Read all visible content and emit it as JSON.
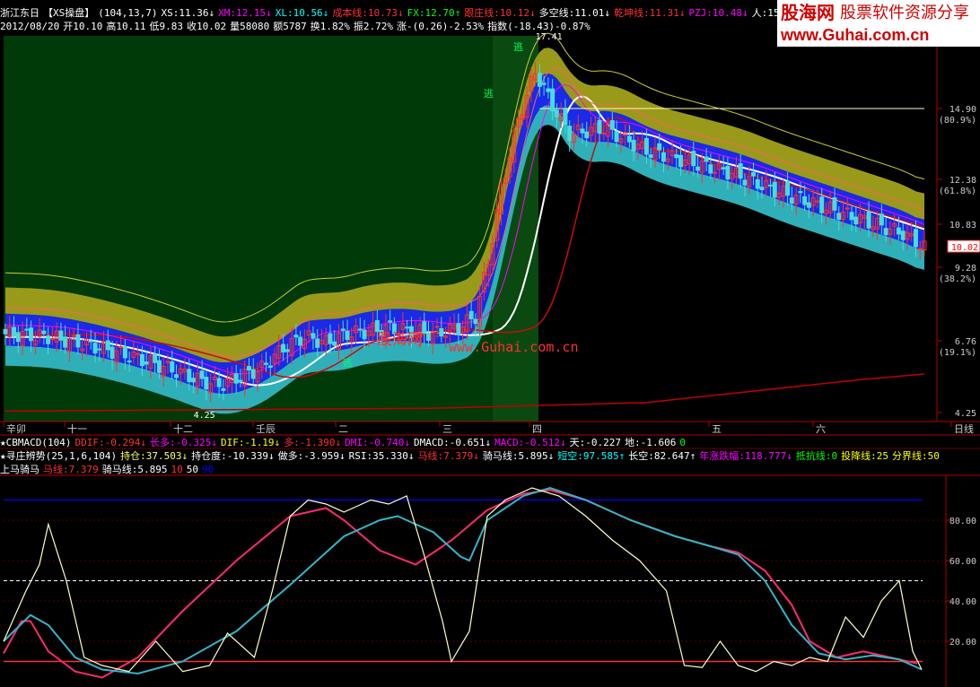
{
  "colors": {
    "bg": "#000000",
    "panel_bg": "#003300",
    "red": "#ff3030",
    "cyan": "#00ffff",
    "yellow": "#ffff00",
    "white": "#ffffff",
    "magenta": "#ff00ff",
    "blue": "#0000ff",
    "teal": "#33aaaa"
  },
  "header": {
    "row1": [
      {
        "t": "浙江东日",
        "c": "#ffffff"
      },
      {
        "t": "【XS操盘】",
        "c": "#ffffff"
      },
      {
        "t": "(104,13,7)",
        "c": "#ffffff"
      },
      {
        "t": "XS:11.36↓",
        "c": "#ffffff"
      },
      {
        "t": "XM:12.15↓",
        "c": "#ff00ff"
      },
      {
        "t": "XL:10.56↓",
        "c": "#00ffff"
      },
      {
        "t": "成本线:10.73↓",
        "c": "#ff3030"
      },
      {
        "t": "FX:12.70↑",
        "c": "#00ff00"
      },
      {
        "t": "跟庄线:10.12↓",
        "c": "#ff3030"
      },
      {
        "t": "多空线:11.01↓",
        "c": "#ffffff"
      },
      {
        "t": "乾坤线:11.31↓",
        "c": "#ff3030"
      },
      {
        "t": "PZJ:10.48↓",
        "c": "#ff00ff"
      },
      {
        "t": "人:15.0",
        "c": "#ffffff"
      }
    ],
    "row2": [
      {
        "t": "2012/08/20",
        "c": "#ffffff"
      },
      {
        "t": "开10.10",
        "c": "#ffffff"
      },
      {
        "t": "高10.11",
        "c": "#ffffff"
      },
      {
        "t": "低9.83",
        "c": "#ffffff"
      },
      {
        "t": "收10.02",
        "c": "#ffffff"
      },
      {
        "t": "量58080",
        "c": "#ffffff"
      },
      {
        "t": "额5787",
        "c": "#ffffff"
      },
      {
        "t": "换1.82%",
        "c": "#ffffff"
      },
      {
        "t": "振2.72%",
        "c": "#ffffff"
      },
      {
        "t": "涨-(0.26)-2.53%",
        "c": "#ffffff"
      },
      {
        "t": "指数(-18.43)-0.87%",
        "c": "#ffffff"
      }
    ]
  },
  "brand": {
    "line1": "股海网",
    "line2": "股票软件资源分享",
    "line3": "www.Guhai.com.cn"
  },
  "watermark": {
    "cn": "股海网",
    "url": "www.Guhai.com.cn"
  },
  "price_panel": {
    "annotations": {
      "peak": "17.41",
      "low": "4.25",
      "escape": "逃",
      "current": "10.02"
    },
    "y_axis": [
      {
        "price": "14.90",
        "pct": "(80.9%)",
        "v": 14.9
      },
      {
        "price": "12.38",
        "pct": "(61.8%)",
        "v": 12.38
      },
      {
        "price": "10.83",
        "pct": "",
        "v": 10.83
      },
      {
        "price": "9.28",
        "pct": "(38.2%)",
        "v": 9.28
      },
      {
        "price": "6.76",
        "pct": "(19.1%)",
        "v": 6.76
      },
      {
        "price": "4.25",
        "pct": "",
        "v": 4.25
      }
    ]
  },
  "time_axis": {
    "labels": [
      "辛卯",
      "十一",
      "十二",
      "壬辰",
      "二",
      "三",
      "四",
      "五",
      "六",
      "日线"
    ]
  },
  "indicator_rows": {
    "row1": [
      {
        "t": "★CBMACD(104)",
        "c": "#ffffff"
      },
      {
        "t": "DDIF:-0.294↓",
        "c": "#ff3030"
      },
      {
        "t": "长多:-0.325↓",
        "c": "#ff00ff"
      },
      {
        "t": "DIF:-1.19↓",
        "c": "#ffff00"
      },
      {
        "t": "多:-1.390↓",
        "c": "#ff3030"
      },
      {
        "t": "DMI:-0.740↓",
        "c": "#ff00ff"
      },
      {
        "t": "DMACD:-0.651↓",
        "c": "#ffffff"
      },
      {
        "t": "MACD:-0.512↓",
        "c": "#ff00ff"
      },
      {
        "t": "天:-0.227",
        "c": "#ffffff"
      },
      {
        "t": "地:-1.606",
        "c": "#ffffff"
      },
      {
        "t": "0",
        "c": "#00ff00"
      }
    ],
    "row2": [
      {
        "t": "★寻庄辨势(25,1,6,104)",
        "c": "#ffffff"
      },
      {
        "t": "持仓:37.503↓",
        "c": "#ffff66"
      },
      {
        "t": "持仓度:-10.339↓",
        "c": "#ffffff"
      },
      {
        "t": "做多:-3.959↓",
        "c": "#ffffff"
      },
      {
        "t": "RSI:35.330↓",
        "c": "#ffffff"
      },
      {
        "t": "马线:7.379↓",
        "c": "#ff3030"
      },
      {
        "t": "骑马线:5.895↓",
        "c": "#ffffff"
      },
      {
        "t": "短空:97.585↑",
        "c": "#00ffff"
      },
      {
        "t": "长空:82.647↑",
        "c": "#ffffff"
      },
      {
        "t": "年涨跌幅:118.777↓",
        "c": "#ff00ff"
      },
      {
        "t": "抵抗线:0",
        "c": "#00ff00"
      },
      {
        "t": "投降线:25",
        "c": "#ffff00"
      },
      {
        "t": "分界线:50",
        "c": "#ffff00"
      }
    ],
    "row3": [
      {
        "t": "上马骑马",
        "c": "#ffffff"
      },
      {
        "t": "马线:7.379",
        "c": "#ff3030"
      },
      {
        "t": "骑马线:5.895",
        "c": "#ffffff"
      },
      {
        "t": "10",
        "c": "#ff3030"
      },
      {
        "t": "50",
        "c": "#ffffff"
      },
      {
        "t": "90",
        "c": "#0000ff"
      }
    ]
  },
  "chart_data": [
    {
      "type": "candlestick",
      "title": "浙江东日【XS操盘】",
      "ylim": [
        4.25,
        17.41
      ],
      "y_ticks": [
        14.9,
        12.38,
        10.83,
        9.28,
        6.76,
        4.25
      ],
      "current_price": 10.02,
      "stage_price_path": [
        [
          0,
          7.0
        ],
        [
          10,
          6.9
        ],
        [
          20,
          6.6
        ],
        [
          30,
          6.2
        ],
        [
          40,
          5.7
        ],
        [
          45,
          5.4
        ],
        [
          50,
          5.2
        ],
        [
          55,
          5.5
        ],
        [
          60,
          5.8
        ],
        [
          65,
          6.5
        ],
        [
          70,
          6.9
        ],
        [
          75,
          6.7
        ],
        [
          80,
          7.0
        ],
        [
          90,
          7.2
        ],
        [
          100,
          7.0
        ],
        [
          106,
          7.2
        ],
        [
          110,
          7.6
        ],
        [
          113,
          9.5
        ],
        [
          116,
          12.0
        ],
        [
          120,
          14.5
        ],
        [
          124,
          16.2
        ],
        [
          128,
          15.0
        ],
        [
          132,
          14.0
        ],
        [
          140,
          14.2
        ],
        [
          150,
          13.4
        ],
        [
          160,
          13.0
        ],
        [
          170,
          12.6
        ],
        [
          180,
          12.0
        ],
        [
          190,
          11.5
        ],
        [
          200,
          11.0
        ],
        [
          210,
          10.5
        ],
        [
          215,
          10.0
        ]
      ],
      "support_line": [
        [
          0,
          4.3
        ],
        [
          100,
          4.4
        ],
        [
          150,
          4.6
        ],
        [
          200,
          5.4
        ],
        [
          215,
          5.6
        ]
      ],
      "resistance_line": [
        [
          125,
          14.9
        ],
        [
          215,
          14.9
        ]
      ]
    },
    {
      "type": "line",
      "title": "上马骑马",
      "ylim": [
        0,
        100
      ],
      "y_ticks": [
        80,
        60,
        40,
        20
      ],
      "reference_lines": [
        10,
        50,
        90
      ],
      "series": [
        {
          "name": "马线",
          "color": "#ff2a6d",
          "values": [
            [
              0,
              14
            ],
            [
              20,
              30
            ],
            [
              30,
              30
            ],
            [
              50,
              15
            ],
            [
              80,
              5
            ],
            [
              110,
              2
            ],
            [
              150,
              12
            ],
            [
              200,
              35
            ],
            [
              260,
              60
            ],
            [
              320,
              82
            ],
            [
              360,
              86
            ],
            [
              380,
              80
            ],
            [
              420,
              65
            ],
            [
              460,
              58
            ],
            [
              500,
              70
            ],
            [
              540,
              85
            ],
            [
              580,
              93
            ],
            [
              610,
              95
            ],
            [
              650,
              90
            ],
            [
              700,
              80
            ],
            [
              750,
              72
            ],
            [
              790,
              67
            ],
            [
              820,
              64
            ],
            [
              850,
              55
            ],
            [
              880,
              38
            ],
            [
              900,
              20
            ],
            [
              930,
              12
            ],
            [
              960,
              15
            ],
            [
              990,
              12
            ],
            [
              1020,
              9
            ]
          ]
        },
        {
          "name": "骑马线",
          "color": "#33b5c6",
          "values": [
            [
              0,
              20
            ],
            [
              30,
              33
            ],
            [
              50,
              28
            ],
            [
              80,
              12
            ],
            [
              110,
              6
            ],
            [
              150,
              4
            ],
            [
              200,
              10
            ],
            [
              260,
              25
            ],
            [
              320,
              48
            ],
            [
              380,
              72
            ],
            [
              420,
              80
            ],
            [
              440,
              82
            ],
            [
              480,
              74
            ],
            [
              510,
              62
            ],
            [
              520,
              60
            ],
            [
              540,
              80
            ],
            [
              580,
              92
            ],
            [
              610,
              96
            ],
            [
              650,
              90
            ],
            [
              700,
              80
            ],
            [
              750,
              72
            ],
            [
              790,
              67
            ],
            [
              820,
              63
            ],
            [
              850,
              50
            ],
            [
              880,
              28
            ],
            [
              910,
              14
            ],
            [
              940,
              11
            ],
            [
              970,
              13
            ],
            [
              1000,
              11
            ],
            [
              1025,
              6
            ]
          ]
        },
        {
          "name": "短空",
          "color": "#ffffcc",
          "values": [
            [
              0,
              20
            ],
            [
              25,
              45
            ],
            [
              40,
              58
            ],
            [
              50,
              78
            ],
            [
              70,
              50
            ],
            [
              90,
              12
            ],
            [
              110,
              8
            ],
            [
              140,
              5
            ],
            [
              170,
              20
            ],
            [
              200,
              5
            ],
            [
              230,
              8
            ],
            [
              250,
              24
            ],
            [
              280,
              12
            ],
            [
              300,
              45
            ],
            [
              320,
              82
            ],
            [
              340,
              90
            ],
            [
              360,
              88
            ],
            [
              380,
              84
            ],
            [
              410,
              90
            ],
            [
              430,
              88
            ],
            [
              450,
              92
            ],
            [
              470,
              62
            ],
            [
              490,
              30
            ],
            [
              500,
              10
            ],
            [
              520,
              25
            ],
            [
              540,
              82
            ],
            [
              560,
              90
            ],
            [
              590,
              96
            ],
            [
              620,
              92
            ],
            [
              650,
              82
            ],
            [
              680,
              70
            ],
            [
              710,
              60
            ],
            [
              740,
              45
            ],
            [
              760,
              8
            ],
            [
              780,
              7
            ],
            [
              800,
              20
            ],
            [
              820,
              8
            ],
            [
              840,
              5
            ],
            [
              860,
              10
            ],
            [
              880,
              8
            ],
            [
              900,
              12
            ],
            [
              920,
              10
            ],
            [
              940,
              32
            ],
            [
              960,
              22
            ],
            [
              980,
              40
            ],
            [
              1000,
              50
            ],
            [
              1015,
              15
            ],
            [
              1025,
              6
            ]
          ]
        }
      ]
    }
  ]
}
